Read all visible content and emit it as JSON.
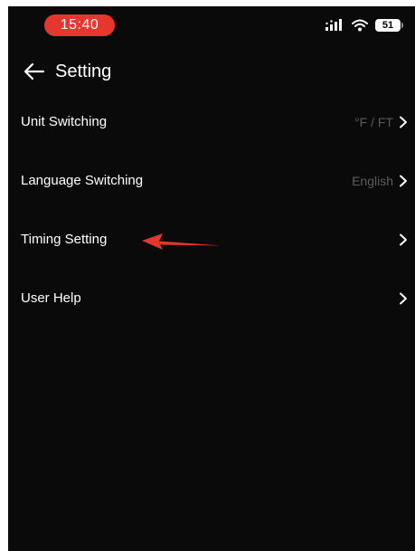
{
  "status_bar": {
    "time": "15:40",
    "battery_level": "51",
    "time_pill_color": "#e6372e",
    "icons": [
      "cellular-signal-icon",
      "wifi-icon",
      "battery-icon"
    ]
  },
  "header": {
    "back_icon": "arrow-left-icon",
    "title": "Setting"
  },
  "settings": [
    {
      "label": "Unit Switching",
      "value": "°F / FT"
    },
    {
      "label": "Language Switching",
      "value": "English"
    },
    {
      "label": "Timing Setting",
      "value": ""
    },
    {
      "label": "User Help",
      "value": ""
    }
  ],
  "annotation": {
    "icon": "red-arrow-pointer-icon",
    "color": "#e6372e",
    "points_to": "Timing Setting"
  }
}
